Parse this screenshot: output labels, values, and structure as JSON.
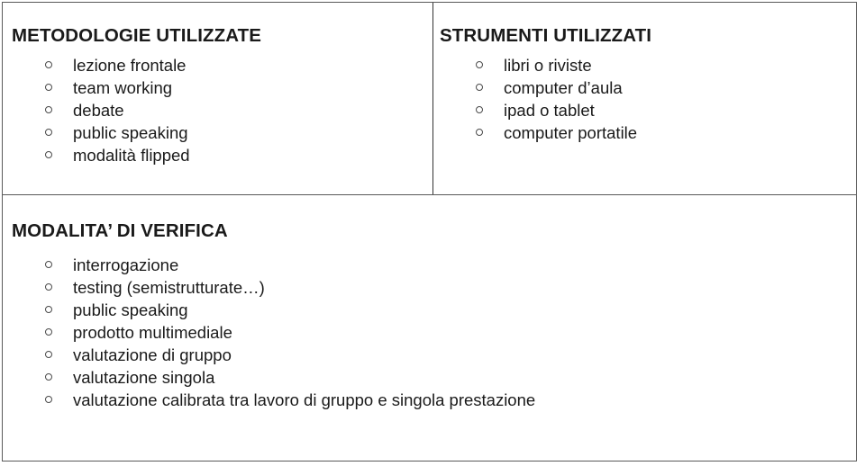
{
  "slide": {
    "panels": {
      "methodologies": {
        "heading": "METODOLOGIE UTILIZZATE",
        "items": [
          "lezione frontale",
          "team working",
          "debate",
          "public speaking",
          "modalità flipped"
        ]
      },
      "tools": {
        "heading": "STRUMENTI UTILIZZATI",
        "items": [
          "libri o riviste",
          "computer d’aula",
          "ipad o tablet",
          "computer portatile"
        ]
      },
      "assessment": {
        "heading": "MODALITA’ DI VERIFICA",
        "items": [
          "interrogazione",
          "testing (semistrutturate…)",
          "public speaking",
          "prodotto multimediale",
          "valutazione di gruppo",
          "valutazione singola",
          "valutazione calibrata tra lavoro di gruppo e singola prestazione"
        ]
      }
    },
    "colors": {
      "text": "#1a1a1a",
      "frame_border": "#595959",
      "divider": "#333333",
      "bullet_marker": "#4a4a4a",
      "background": "#ffffff"
    },
    "bullet_glyph": "open-circle"
  }
}
